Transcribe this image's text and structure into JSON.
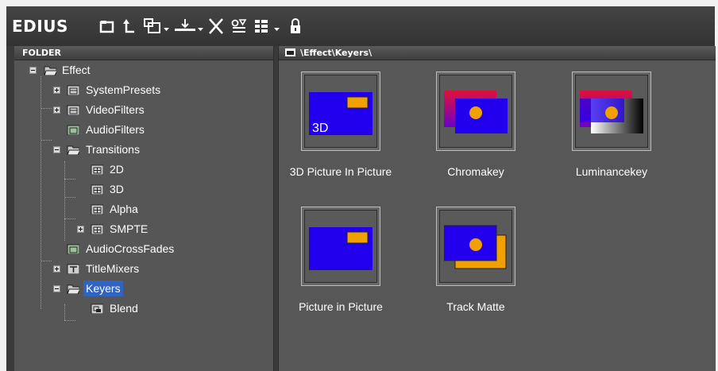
{
  "app": {
    "brand": "EDIUS"
  },
  "toolbar": {
    "icons": [
      "new-folder-icon",
      "up-folder-icon",
      "copy-dropdown-icon",
      "import-dropdown-icon",
      "delete-icon",
      "properties-icon",
      "view-mode-dropdown-icon",
      "lock-icon"
    ]
  },
  "folder_panel": {
    "header": "FOLDER",
    "tree": [
      {
        "label": "Effect"
      },
      {
        "label": "SystemPresets"
      },
      {
        "label": "VideoFilters"
      },
      {
        "label": "AudioFilters"
      },
      {
        "label": "Transitions"
      },
      {
        "label": "2D"
      },
      {
        "label": "3D"
      },
      {
        "label": "Alpha"
      },
      {
        "label": "SMPTE"
      },
      {
        "label": "AudioCrossFades"
      },
      {
        "label": "TitleMixers"
      },
      {
        "label": "Keyers",
        "selected": true
      },
      {
        "label": "Blend"
      }
    ]
  },
  "content_panel": {
    "path": "\\Effect\\Keyers\\",
    "items": [
      {
        "label": "3D Picture In Picture",
        "thumb_text": "3D"
      },
      {
        "label": "Chromakey"
      },
      {
        "label": "Luminancekey"
      },
      {
        "label": "Picture in Picture"
      },
      {
        "label": "Track Matte"
      }
    ]
  },
  "colors": {
    "selection": "#3163c0",
    "thumb_blue": "#2200ee",
    "thumb_orange": "#f0a000",
    "thumb_red": "#e0103c"
  }
}
